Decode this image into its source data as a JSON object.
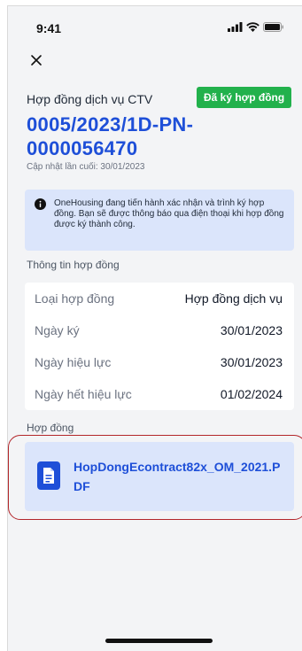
{
  "status_bar": {
    "time": "9:41"
  },
  "header": {
    "title": "Hợp đồng dịch vụ CTV",
    "status_badge": "Đã ký hợp đồng",
    "contract_number": "0005/2023/1D-PN-0000056470",
    "last_updated": "Cập nhật lần cuối: 30/01/2023"
  },
  "notice": {
    "text": "OneHousing đang tiến hành xác nhận và trình ký hợp đồng. Bạn sẽ được thông báo qua điện thoại khi hợp đồng được ký thành công."
  },
  "contract_info": {
    "section_title": "Thông tin hợp đồng",
    "rows": [
      {
        "label": "Loại hợp đồng",
        "value": "Hợp đồng dịch vụ"
      },
      {
        "label": "Ngày ký",
        "value": "30/01/2023"
      },
      {
        "label": "Ngày hiệu lực",
        "value": "30/01/2023"
      },
      {
        "label": "Ngày hết hiệu lực",
        "value": "01/02/2024"
      }
    ]
  },
  "contract_file": {
    "section_title": "Hợp đồng",
    "file_name": "HopDongEcontract82x_OM_2021.PDF"
  },
  "colors": {
    "accent": "#1e4fd8",
    "badge_green": "#22b14c",
    "notice_bg": "#dbe5fb",
    "highlight": "#b3262a"
  }
}
